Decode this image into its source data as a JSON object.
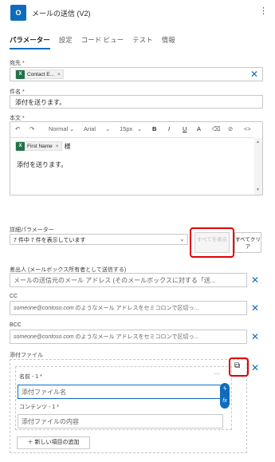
{
  "header": {
    "app_icon": "O",
    "title": "メールの送信 (V2)",
    "more": "⋮"
  },
  "tabs": [
    {
      "label": "パラメーター",
      "active": true
    },
    {
      "label": "設定"
    },
    {
      "label": "コード ビュー"
    },
    {
      "label": "テスト"
    },
    {
      "label": "情報"
    }
  ],
  "to": {
    "label": "宛先",
    "required": "*",
    "token_label": "Contact E...",
    "token_remove": "×"
  },
  "subject": {
    "label": "件名",
    "required": "*",
    "value": "添付を送ります。"
  },
  "body": {
    "label": "本文",
    "required": "*",
    "toolbar": {
      "undo": "↶",
      "redo": "↷",
      "style": "Normal",
      "font": "Arial",
      "size": "15px",
      "bold": "B",
      "italic": "I",
      "underline": "U",
      "font_color": "A",
      "highlight": "⌫",
      "link": "⊘",
      "code": "<>"
    },
    "token_label": "First Name",
    "token_remove": "×",
    "suffix": "様",
    "text": "添付を送ります。"
  },
  "advanced": {
    "label": "詳細パラメーター",
    "dropdown_text": "7 件中 7 件を表示しています",
    "show_all": "すべてを表示",
    "clear_all": "すべてクリア"
  },
  "from": {
    "label": "差出人 (メールボックス所有者として送信する)",
    "placeholder": "メールの送信元のメール アドレス (そのメールボックスに対する「送..."
  },
  "cc": {
    "label": "CC",
    "placeholder_em": "someone@contoso.com",
    "placeholder_rest": " のようなメール アドレスをセミコロンで区切っ..."
  },
  "bcc": {
    "label": "BCC",
    "placeholder_em": "someone@contoso.com",
    "placeholder_rest": " のようなメール アドレスをセミコロンで区切っ..."
  },
  "attachments": {
    "label": "添付ファイル",
    "name_label": "名前 - 1",
    "name_req": "*",
    "name_placeholder": "添付ファイル名",
    "content_label": "コンテンツ - 1",
    "content_req": "*",
    "content_placeholder": "添付ファイルの内容",
    "add_item": "新しい項目の追加",
    "row_more": "···"
  },
  "colors": {
    "accent": "#0f6cbd",
    "highlight": "#e00000",
    "excel": "#217346"
  }
}
